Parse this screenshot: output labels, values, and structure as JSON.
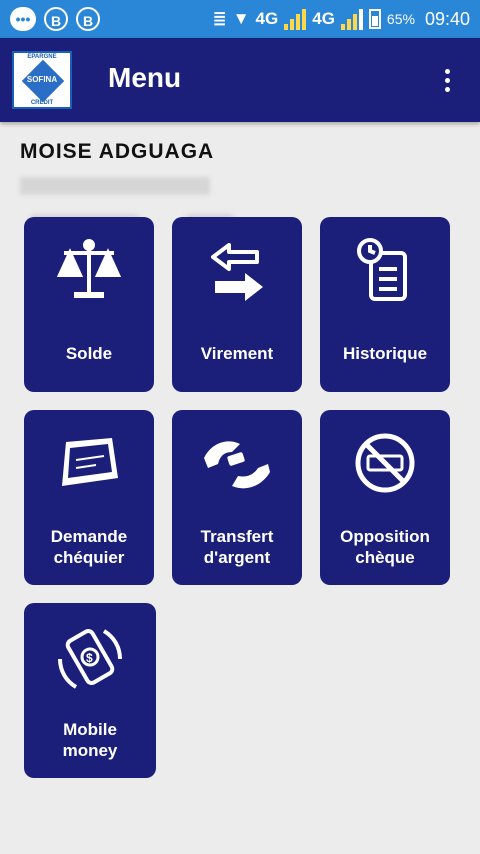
{
  "status_bar": {
    "network_1": "4G",
    "network_2": "4G",
    "battery": "65%",
    "time": "09:40"
  },
  "app_bar": {
    "title": "Menu",
    "logo": {
      "brand": "SOFINA",
      "top": "EPARGNE",
      "bottom": "CREDIT"
    }
  },
  "header": {
    "user_name": "MOISE ADGUAGA"
  },
  "menu": {
    "items": [
      {
        "label": "Solde",
        "icon": "balance-scale-icon"
      },
      {
        "label": "Virement",
        "icon": "transfer-arrows-icon"
      },
      {
        "label": "Historique",
        "icon": "history-clipboard-icon"
      },
      {
        "label": "Demande chéquier",
        "icon": "checkbook-icon"
      },
      {
        "label": "Transfert d'argent",
        "icon": "money-transfer-hands-icon"
      },
      {
        "label": "Opposition chèque",
        "icon": "cheque-block-icon"
      },
      {
        "label": "Mobile money",
        "icon": "mobile-money-icon"
      }
    ]
  }
}
